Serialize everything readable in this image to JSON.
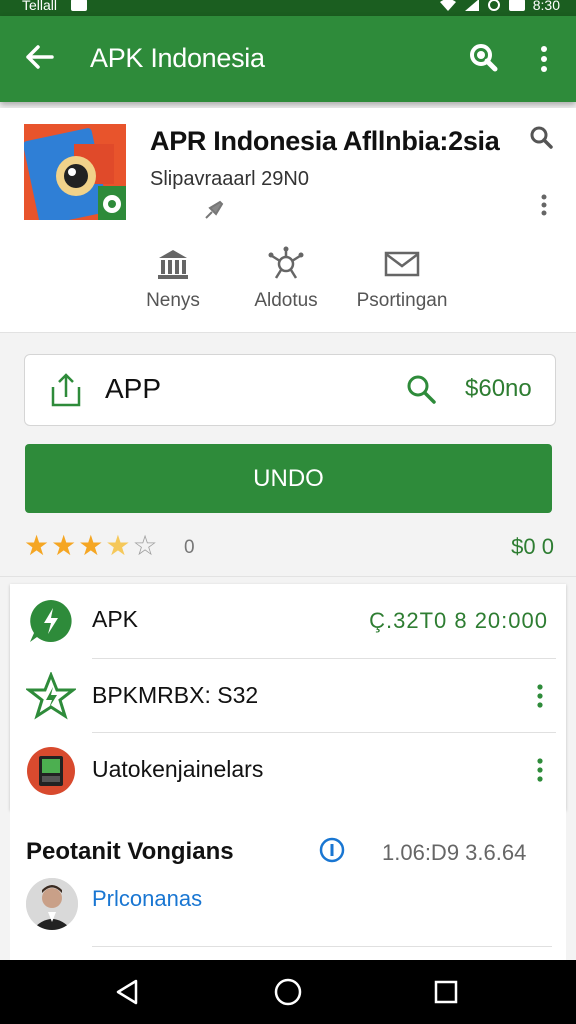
{
  "status_bar": {
    "left_text": "Tellall",
    "right_text": "8:30"
  },
  "app_bar": {
    "title": "APK Indonesia"
  },
  "app_header": {
    "name": "APR Indonesia Afllnbia:2sia",
    "subtitle": "Slipavraaarl 29N0",
    "actions": [
      {
        "label": "Nenys",
        "icon": "bank-icon"
      },
      {
        "label": "Aldotus",
        "icon": "network-icon"
      },
      {
        "label": "Psortingan",
        "icon": "mail-icon"
      }
    ]
  },
  "search_box": {
    "label": "APP",
    "price": "$60no"
  },
  "main_button": {
    "label": "UNDO"
  },
  "rating": {
    "value": 3.5,
    "max": 5,
    "count": "0",
    "right_text": "$0 0"
  },
  "list": [
    {
      "text": "APK",
      "value": "Ç.32T0 8  20:000",
      "icon": "whatsapp-icon"
    },
    {
      "text": "BPKMRBX: S32",
      "icon": "star-badge-icon"
    },
    {
      "text": "Uatokenjainelars",
      "icon": "device-icon"
    }
  ],
  "section": {
    "title": "Peotanit Vongians",
    "version": "1.06:D9 3.6.64",
    "developer": "Prlconanas"
  },
  "colors": {
    "primary": "#2e8b3a",
    "accent_text": "#2e7d32",
    "link": "#1976d2"
  }
}
